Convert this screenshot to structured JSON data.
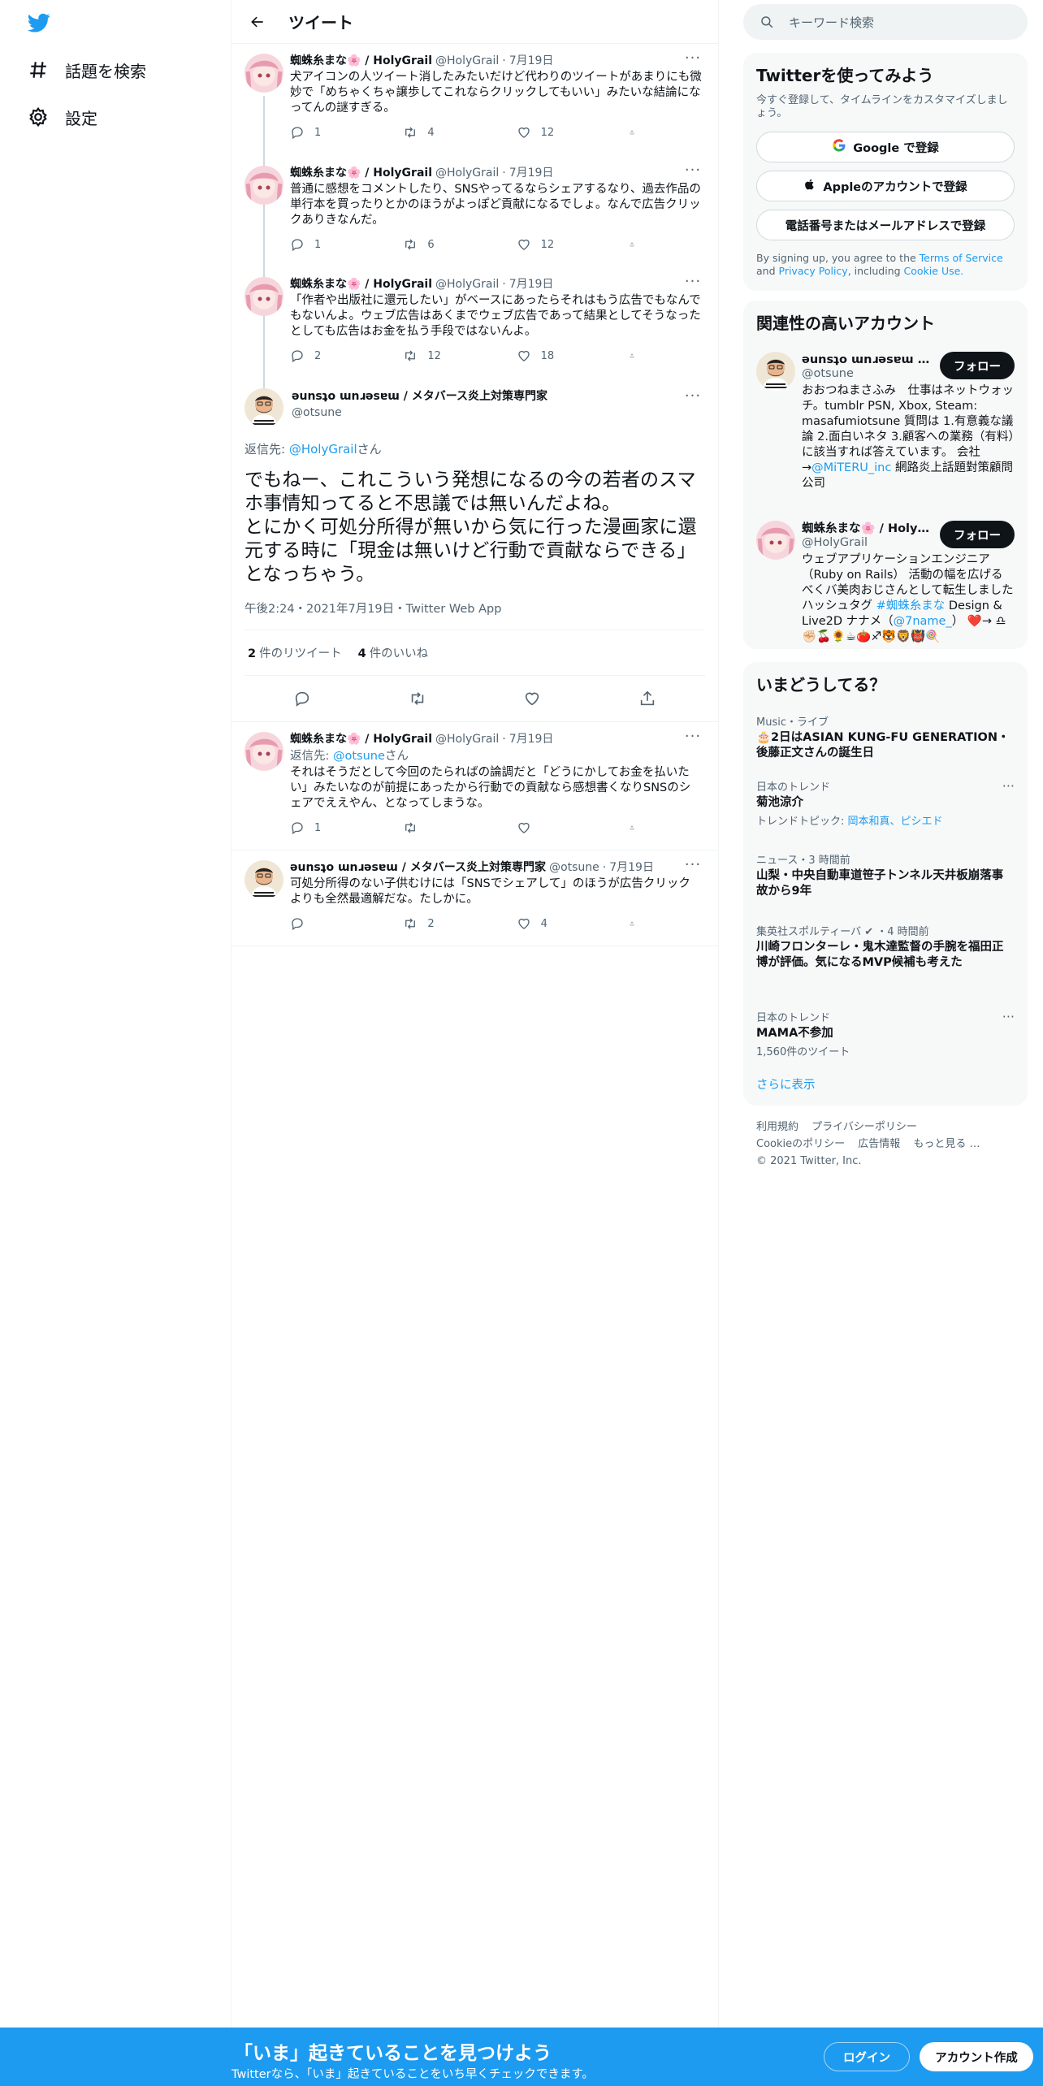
{
  "nav": {
    "explore_label": "話題を検索",
    "settings_label": "設定"
  },
  "header": {
    "title": "ツイート"
  },
  "tweets_before": [
    {
      "name": "蜘蛛糸まな🌸 / HolyGrail",
      "handle": "@HolyGrail",
      "date": "7月19日",
      "text": "犬アイコンの人ツイート消したみたいだけど代わりのツイートがあまりにも微妙で「めちゃくちゃ譲歩してこれならクリックしてもいい」みたいな結論になってんの謎すぎる。",
      "replies": "1",
      "retweets": "4",
      "likes": "12"
    },
    {
      "name": "蜘蛛糸まな🌸 / HolyGrail",
      "handle": "@HolyGrail",
      "date": "7月19日",
      "text": "普通に感想をコメントしたり、SNSやってるならシェアするなり、過去作品の単行本を買ったりとかのほうがよっぽど貢献になるでしょ。なんで広告クリックありきなんだ。",
      "replies": "1",
      "retweets": "6",
      "likes": "12"
    },
    {
      "name": "蜘蛛糸まな🌸 / HolyGrail",
      "handle": "@HolyGrail",
      "date": "7月19日",
      "text": "「作者や出版社に還元したい」がベースにあったらそれはもう広告でもなんでもないんよ。ウェブ広告はあくまでウェブ広告であって結果としてそうなったとしても広告はお金を払う手段ではないんよ。",
      "replies": "2",
      "retweets": "12",
      "likes": "18"
    }
  ],
  "focus": {
    "name": "ǝunsʇo ɯnɹǝsɐɯ / メタバース炎上対策専門家",
    "handle": "@otsune",
    "reply_prefix": "返信先: ",
    "reply_to": "@HolyGrail",
    "reply_suffix": "さん",
    "text_line1": "でもねー、これこういう発想になるの今の若者のスマホ事情知ってると不思議では無いんだよね。",
    "text_line2": "とにかく可処分所得が無いから気に行った漫画家に還元する時に「現金は無いけど行動で貢献ならできる」となっちゃう。",
    "meta": "午後2:24・2021年7月19日・Twitter Web App",
    "retweet_count": "2",
    "retweet_label": "件のリツイート",
    "like_count": "4",
    "like_label": "件のいいね"
  },
  "tweets_after": [
    {
      "name": "蜘蛛糸まな🌸 / HolyGrail",
      "handle": "@HolyGrail",
      "date": "7月19日",
      "reply_prefix": "返信先: ",
      "reply_to": "@otsune",
      "reply_suffix": "さん",
      "text": "それはそうだとして今回のたらればの論調だと「どうにかしてお金を払いたい」みたいなのが前提にあったから行動での貢献なら感想書くなりSNSのシェアでええやん、となってしまうな。",
      "replies": "1",
      "retweets": "",
      "likes": ""
    },
    {
      "name": "ǝunsʇo ɯnɹǝsɐɯ / メタバース炎上対策専門家",
      "handle": "@otsune",
      "date": "7月19日",
      "text": "可処分所得のない子供むけには「SNSでシェアして」のほうが広告クリックよりも全然最適解だな。たしかに。",
      "replies": "",
      "retweets": "2",
      "likes": "4"
    }
  ],
  "search": {
    "placeholder": "キーワード検索"
  },
  "signup": {
    "title": "Twitterを使ってみよう",
    "subtitle": "今すぐ登録して、タイムラインをカスタマイズしましょう。",
    "google": "Google で登録",
    "apple": "Appleのアカウントで登録",
    "phone": "電話番号またはメールアドレスで登録",
    "legal_prefix": "By signing up, you agree to the ",
    "terms": "Terms of Service",
    "and": " and ",
    "privacy": "Privacy Policy",
    "including": ", including ",
    "cookie": "Cookie Use."
  },
  "related": {
    "title": "関連性の高いアカウント",
    "follow_label": "フォロー",
    "accounts": [
      {
        "name": "ǝunsʇo ɯnɹǝsɐɯ / メタバース炎上対策専門家",
        "handle": "@otsune",
        "bio_a": "おおつねまさふみ　仕事はネットウォッチ。tumblr PSN, Xbox, Steam: masafumiotsune 質問は 1.有意義な議論 2.面白いネタ 3.顧客への業務（有料）に該当すれば答えています。 会社→",
        "bio_link": "@MiTERU_inc",
        "bio_b": " 網路炎上話題對策顧問公司"
      },
      {
        "name": "蜘蛛糸まな🌸 / HolyGrail",
        "handle": "@HolyGrail",
        "bio_a": "ウェブアプリケーションエンジニア（Ruby on Rails） 活動の幅を広げるべくバ美肉おじさんとして転生しました ハッシュタグ ",
        "bio_link": "#蜘蛛糸まな",
        "bio_b": " Design & Live2D ナナメ（",
        "bio_link2": "@7name_",
        "bio_c": "） ❤️→ ♎✊🏻🍒🌻☕🍅♐🐯🦁👹🍭"
      }
    ]
  },
  "trends": {
    "title": "いまどうしてる？",
    "items": [
      {
        "context": "Music・ライブ",
        "title": "🎂2日はASIAN KUNG-FU GENERATION・後藤正文さんの誕生日",
        "extra": ""
      },
      {
        "context": "日本のトレンド",
        "title": "菊池涼介",
        "extra_prefix": "トレンドトピック: ",
        "extra_links": "岡本和真、ピシエド"
      },
      {
        "context": "ニュース・3 時間前",
        "title": "山梨・中央自動車道笹子トンネル天井板崩落事故から9年",
        "extra": ""
      },
      {
        "context": "集英社スポルティーバ ✔ ・4 時間前",
        "title": "川崎フロンターレ・鬼木達監督の手腕を福田正博が評価。気になるMVP候補も考えた",
        "extra": ""
      },
      {
        "context": "日本のトレンド",
        "title": "MAMA不参加",
        "extra": "1,560件のツイート"
      }
    ],
    "show_more": "さらに表示"
  },
  "footer": {
    "links": [
      "利用規約",
      "プライバシーポリシー",
      "Cookieのポリシー",
      "広告情報",
      "もっと見る …"
    ],
    "copyright": "© 2021 Twitter, Inc."
  },
  "bottom": {
    "heading": "「いま」起きていることを見つけよう",
    "sub": "Twitterなら、「いま」起きていることをいち早くチェックできます。",
    "login": "ログイン",
    "signup": "アカウント作成"
  },
  "colors": {
    "accent": "#1d9bf0",
    "text": "#0f1419",
    "muted": "#536471",
    "panel": "#f7f9f9"
  }
}
